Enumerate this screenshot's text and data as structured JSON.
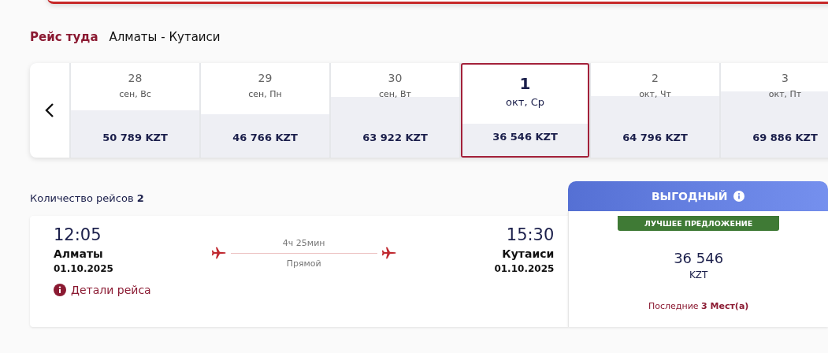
{
  "heading": {
    "title": "Рейс туда",
    "route": "Алматы - Кутаиси"
  },
  "date_strip": {
    "days": [
      {
        "day": "28",
        "label": "сен, Вс",
        "price": "50 789 KZT",
        "selected": false
      },
      {
        "day": "29",
        "label": "сен, Пн",
        "price": "46 766 KZT",
        "selected": false
      },
      {
        "day": "30",
        "label": "сен, Вт",
        "price": "63 922 KZT",
        "selected": false
      },
      {
        "day": "1",
        "label": "окт, Ср",
        "price": "36 546 KZT",
        "selected": true
      },
      {
        "day": "2",
        "label": "окт, Чт",
        "price": "64 796 KZT",
        "selected": false
      },
      {
        "day": "3",
        "label": "окт, Пт",
        "price": "69 886 KZT",
        "selected": false
      }
    ]
  },
  "flights_count": "Количество рейсов **2**",
  "flight": {
    "depart_time": "12:05",
    "depart_city": "Алматы",
    "depart_date": "01.10.2025",
    "duration": "4ч 25мин",
    "stops": "Прямой",
    "arrive_time": "15:30",
    "arrive_city": "Кутаиси",
    "arrive_date": "01.10.2025",
    "details_link": "Детали рейса"
  },
  "fare": {
    "name": "ВЫГОДНЫЙ",
    "badge": "ЛУЧШЕЕ ПРЕДЛОЖЕНИЕ",
    "price": "36 546",
    "currency": "KZT",
    "seats_note": "Последние **3 Мест(а)**"
  }
}
